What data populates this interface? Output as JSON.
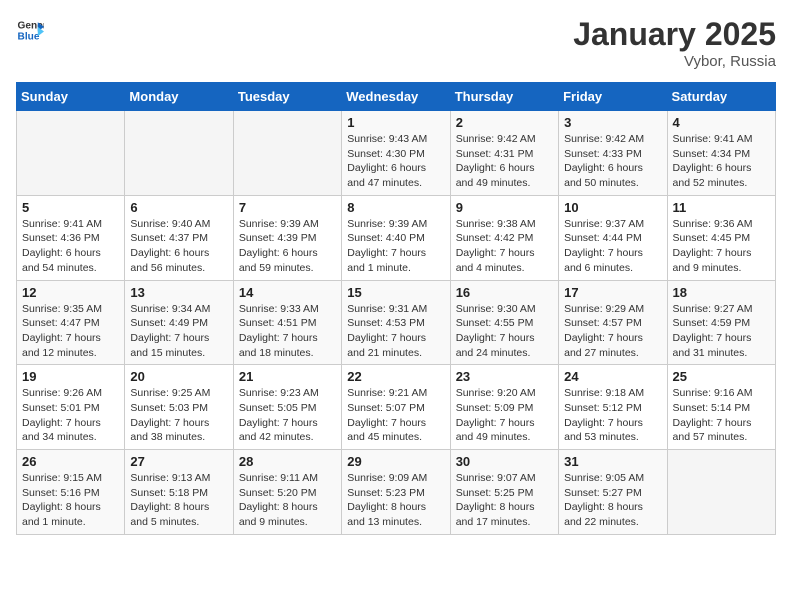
{
  "header": {
    "logo_general": "General",
    "logo_blue": "Blue",
    "month_title": "January 2025",
    "location": "Vybor, Russia"
  },
  "days_of_week": [
    "Sunday",
    "Monday",
    "Tuesday",
    "Wednesday",
    "Thursday",
    "Friday",
    "Saturday"
  ],
  "weeks": [
    [
      {
        "day": "",
        "info": ""
      },
      {
        "day": "",
        "info": ""
      },
      {
        "day": "",
        "info": ""
      },
      {
        "day": "1",
        "info": "Sunrise: 9:43 AM\nSunset: 4:30 PM\nDaylight: 6 hours and 47 minutes."
      },
      {
        "day": "2",
        "info": "Sunrise: 9:42 AM\nSunset: 4:31 PM\nDaylight: 6 hours and 49 minutes."
      },
      {
        "day": "3",
        "info": "Sunrise: 9:42 AM\nSunset: 4:33 PM\nDaylight: 6 hours and 50 minutes."
      },
      {
        "day": "4",
        "info": "Sunrise: 9:41 AM\nSunset: 4:34 PM\nDaylight: 6 hours and 52 minutes."
      }
    ],
    [
      {
        "day": "5",
        "info": "Sunrise: 9:41 AM\nSunset: 4:36 PM\nDaylight: 6 hours and 54 minutes."
      },
      {
        "day": "6",
        "info": "Sunrise: 9:40 AM\nSunset: 4:37 PM\nDaylight: 6 hours and 56 minutes."
      },
      {
        "day": "7",
        "info": "Sunrise: 9:39 AM\nSunset: 4:39 PM\nDaylight: 6 hours and 59 minutes."
      },
      {
        "day": "8",
        "info": "Sunrise: 9:39 AM\nSunset: 4:40 PM\nDaylight: 7 hours and 1 minute."
      },
      {
        "day": "9",
        "info": "Sunrise: 9:38 AM\nSunset: 4:42 PM\nDaylight: 7 hours and 4 minutes."
      },
      {
        "day": "10",
        "info": "Sunrise: 9:37 AM\nSunset: 4:44 PM\nDaylight: 7 hours and 6 minutes."
      },
      {
        "day": "11",
        "info": "Sunrise: 9:36 AM\nSunset: 4:45 PM\nDaylight: 7 hours and 9 minutes."
      }
    ],
    [
      {
        "day": "12",
        "info": "Sunrise: 9:35 AM\nSunset: 4:47 PM\nDaylight: 7 hours and 12 minutes."
      },
      {
        "day": "13",
        "info": "Sunrise: 9:34 AM\nSunset: 4:49 PM\nDaylight: 7 hours and 15 minutes."
      },
      {
        "day": "14",
        "info": "Sunrise: 9:33 AM\nSunset: 4:51 PM\nDaylight: 7 hours and 18 minutes."
      },
      {
        "day": "15",
        "info": "Sunrise: 9:31 AM\nSunset: 4:53 PM\nDaylight: 7 hours and 21 minutes."
      },
      {
        "day": "16",
        "info": "Sunrise: 9:30 AM\nSunset: 4:55 PM\nDaylight: 7 hours and 24 minutes."
      },
      {
        "day": "17",
        "info": "Sunrise: 9:29 AM\nSunset: 4:57 PM\nDaylight: 7 hours and 27 minutes."
      },
      {
        "day": "18",
        "info": "Sunrise: 9:27 AM\nSunset: 4:59 PM\nDaylight: 7 hours and 31 minutes."
      }
    ],
    [
      {
        "day": "19",
        "info": "Sunrise: 9:26 AM\nSunset: 5:01 PM\nDaylight: 7 hours and 34 minutes."
      },
      {
        "day": "20",
        "info": "Sunrise: 9:25 AM\nSunset: 5:03 PM\nDaylight: 7 hours and 38 minutes."
      },
      {
        "day": "21",
        "info": "Sunrise: 9:23 AM\nSunset: 5:05 PM\nDaylight: 7 hours and 42 minutes."
      },
      {
        "day": "22",
        "info": "Sunrise: 9:21 AM\nSunset: 5:07 PM\nDaylight: 7 hours and 45 minutes."
      },
      {
        "day": "23",
        "info": "Sunrise: 9:20 AM\nSunset: 5:09 PM\nDaylight: 7 hours and 49 minutes."
      },
      {
        "day": "24",
        "info": "Sunrise: 9:18 AM\nSunset: 5:12 PM\nDaylight: 7 hours and 53 minutes."
      },
      {
        "day": "25",
        "info": "Sunrise: 9:16 AM\nSunset: 5:14 PM\nDaylight: 7 hours and 57 minutes."
      }
    ],
    [
      {
        "day": "26",
        "info": "Sunrise: 9:15 AM\nSunset: 5:16 PM\nDaylight: 8 hours and 1 minute."
      },
      {
        "day": "27",
        "info": "Sunrise: 9:13 AM\nSunset: 5:18 PM\nDaylight: 8 hours and 5 minutes."
      },
      {
        "day": "28",
        "info": "Sunrise: 9:11 AM\nSunset: 5:20 PM\nDaylight: 8 hours and 9 minutes."
      },
      {
        "day": "29",
        "info": "Sunrise: 9:09 AM\nSunset: 5:23 PM\nDaylight: 8 hours and 13 minutes."
      },
      {
        "day": "30",
        "info": "Sunrise: 9:07 AM\nSunset: 5:25 PM\nDaylight: 8 hours and 17 minutes."
      },
      {
        "day": "31",
        "info": "Sunrise: 9:05 AM\nSunset: 5:27 PM\nDaylight: 8 hours and 22 minutes."
      },
      {
        "day": "",
        "info": ""
      }
    ]
  ]
}
